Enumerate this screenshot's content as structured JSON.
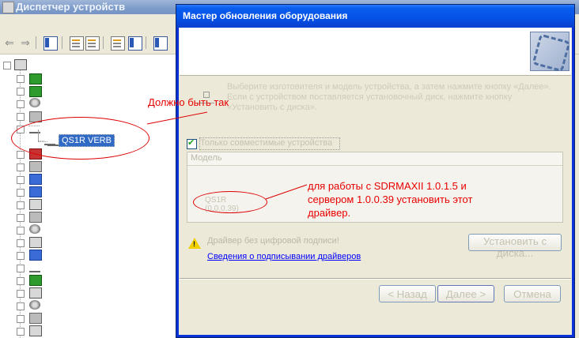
{
  "device_manager": {
    "title": "Диспетчер устройств",
    "selected_device": "QS1R VERB"
  },
  "wizard": {
    "title": "Мастер обновления оборудования",
    "intro_text_faded": "Выберите изготовителя и модель устройства, а затем нажмите кнопку «Далее». Если с устройством поставляется установочный диск, нажмите кнопку «Установить с диска».",
    "compat_label": "Только совместимые устройства",
    "list_header": "Модель",
    "list_item": "QS1R (0.0.0.39)",
    "unsigned_text": "Драйвер без цифровой подписи!",
    "sign_link": "Сведения о подписывании драйверов",
    "have_disk_label": "Установить с диска...",
    "back_label": "< Назад",
    "next_label": "Далее >",
    "cancel_label": "Отмена"
  },
  "annotations": {
    "top_note": "Должно быть так",
    "driver_note": "для работы с SDRMAXII 1.0.1.5 и сервером 1.0.0.39 установить этот драйвер.",
    "color": "#e80000"
  }
}
